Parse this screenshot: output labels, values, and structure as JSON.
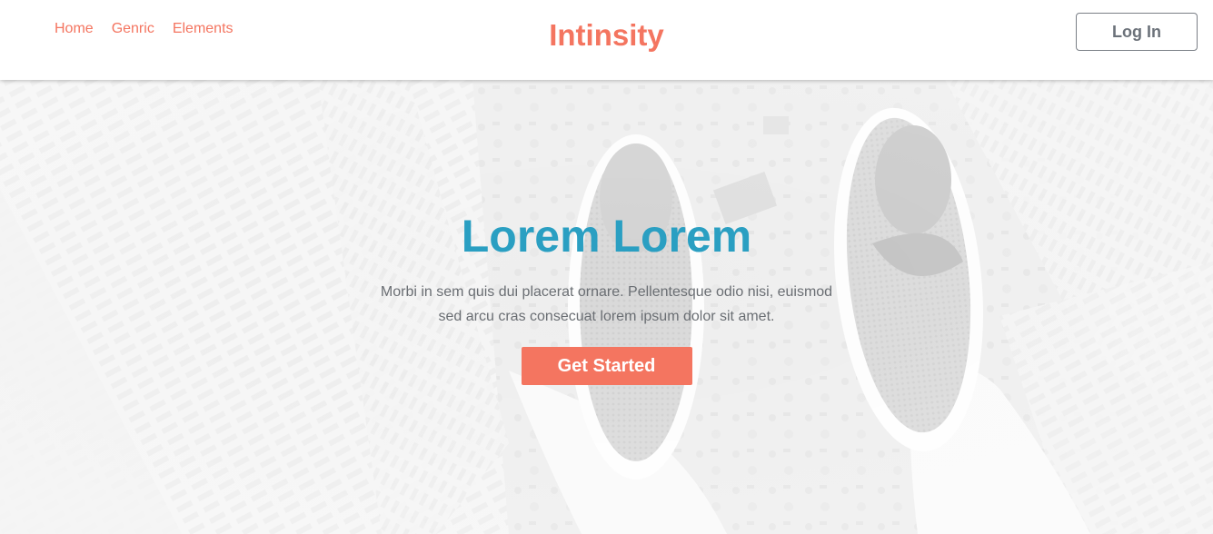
{
  "header": {
    "brand": "Intinsity",
    "nav": [
      {
        "label": "Home"
      },
      {
        "label": "Genric"
      },
      {
        "label": "Elements"
      }
    ],
    "login_label": "Log In"
  },
  "hero": {
    "title": "Lorem Lorem",
    "description": "Morbi in sem quis dui placerat ornare. Pellentesque odio nisi, euismod sed arcu cras consecuat lorem ipsum dolor sit amet.",
    "cta_label": "Get Started",
    "background_image": "city-view-from-above-with-feet-photo"
  },
  "colors": {
    "accent": "#f47560",
    "title": "#2a9fc2",
    "body_text": "#6a6e73"
  }
}
